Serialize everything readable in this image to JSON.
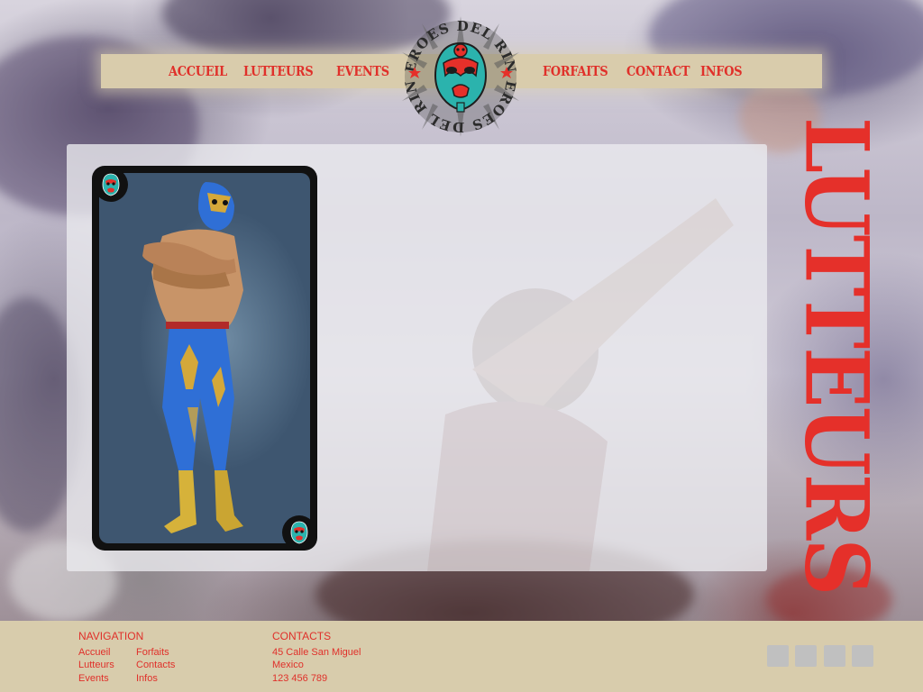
{
  "nav": {
    "left": [
      "ACCUEIL",
      "LUTTEURS",
      "EVENTS"
    ],
    "right": [
      "FORFAITS",
      "CONTACT",
      "INFOS"
    ]
  },
  "logo": {
    "text_top": "HEROES DEL RING",
    "text_bottom": "HEROES DEL RING",
    "icon": "luchador-mask-icon"
  },
  "page": {
    "title": "LUTTEURS"
  },
  "card": {
    "image": "wrestler-photo",
    "badge_icon": "luchador-mask-icon"
  },
  "footer": {
    "navigation": {
      "heading": "NAVIGATION",
      "col1": [
        "Accueil",
        "Lutteurs",
        "Events"
      ],
      "col2": [
        "Forfaits",
        "Contacts",
        "Infos"
      ]
    },
    "contacts": {
      "heading": "CONTACTS",
      "lines": [
        "45 Calle San Miguel",
        "Mexico",
        "123 456 789"
      ]
    },
    "social_icons": [
      "social-icon-1",
      "social-icon-2",
      "social-icon-3",
      "social-icon-4"
    ]
  },
  "colors": {
    "accent": "#e5302a",
    "bar": "#d9ccac",
    "mask": "#29b3ad"
  }
}
